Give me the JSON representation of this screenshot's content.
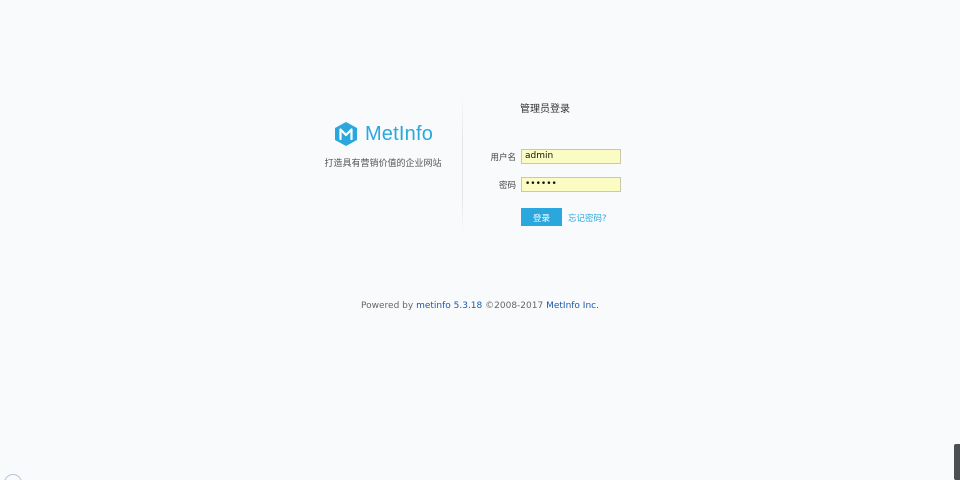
{
  "brand": {
    "logo_text": "MetInfo",
    "slogan": "打造具有营销价值的企业网站",
    "logo_color": "#2aa8de"
  },
  "login": {
    "title": "管理员登录",
    "username_label": "用户名",
    "username_value": "admin",
    "password_label": "密码",
    "password_value": "••••••",
    "submit_label": "登录",
    "forgot_label": "忘记密码?"
  },
  "footer": {
    "powered_by": "Powered by",
    "product_link": "metinfo 5.3.18",
    "copyright": "©2008-2017",
    "company_link": "MetInfo Inc."
  },
  "colors": {
    "accent": "#2aa8de",
    "input_bg": "#fbfbc4",
    "link_dark": "#1b5aa8"
  }
}
